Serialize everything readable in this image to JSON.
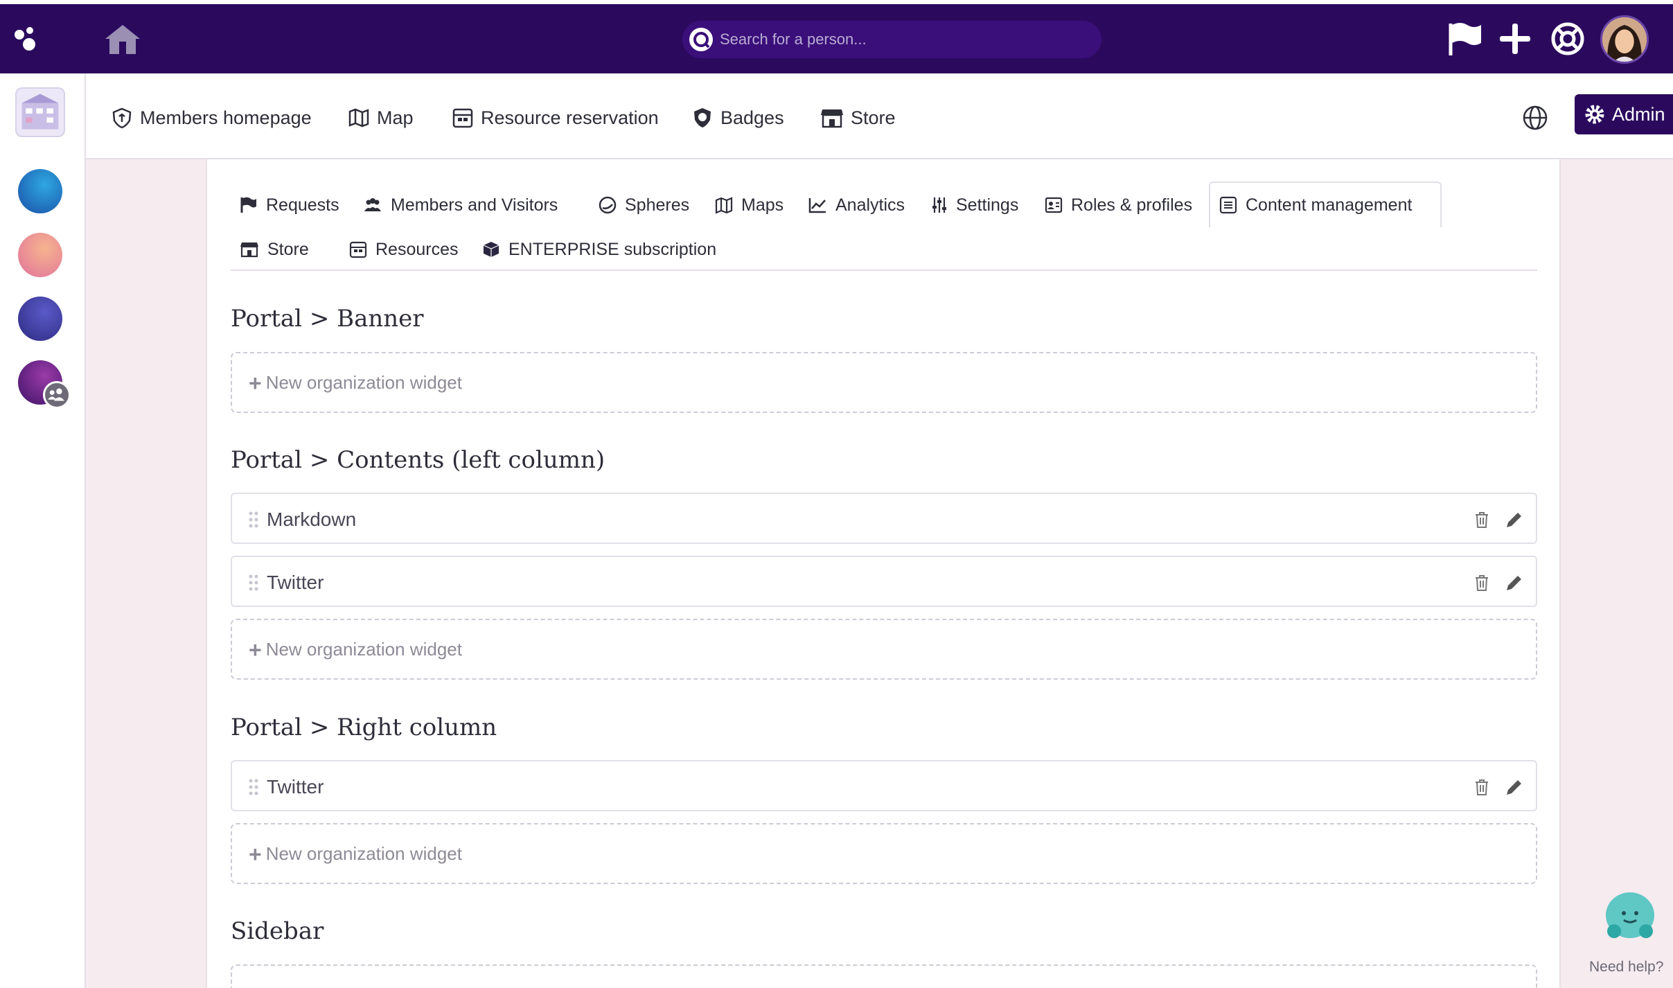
{
  "topbar": {
    "search_placeholder": "Search for a person...",
    "icons": [
      "logo-icon",
      "home-icon",
      "flag-icon",
      "plus-icon",
      "help-ring-icon",
      "user-avatar"
    ]
  },
  "rail": {
    "spheres": [
      {
        "name": "sphere-blue",
        "color": "#1f74c9"
      },
      {
        "name": "sphere-pink",
        "color": "#e98a98"
      },
      {
        "name": "sphere-indigo",
        "color": "#3b3a9a"
      },
      {
        "name": "sphere-purple",
        "color": "#5a1f7a"
      }
    ]
  },
  "navbar": {
    "items": [
      {
        "label": "Members homepage",
        "icon": "shield-home-icon"
      },
      {
        "label": "Map",
        "icon": "map-icon"
      },
      {
        "label": "Resource reservation",
        "icon": "calendar-icon"
      },
      {
        "label": "Badges",
        "icon": "badge-icon"
      },
      {
        "label": "Store",
        "icon": "store-icon"
      }
    ],
    "admin_label": "Admin"
  },
  "tabs": {
    "row1": [
      {
        "label": "Requests",
        "icon": "flag-icon"
      },
      {
        "label": "Members and Visitors",
        "icon": "users-icon"
      },
      {
        "label": "Spheres",
        "icon": "sphere-icon"
      },
      {
        "label": "Maps",
        "icon": "map-icon"
      },
      {
        "label": "Analytics",
        "icon": "chart-line-icon"
      },
      {
        "label": "Settings",
        "icon": "sliders-icon"
      },
      {
        "label": "Roles & profiles",
        "icon": "id-card-icon"
      },
      {
        "label": "Content management",
        "icon": "list-icon",
        "active": true
      }
    ],
    "row2": [
      {
        "label": "Store",
        "icon": "store-icon"
      },
      {
        "label": "Resources",
        "icon": "calendar-icon"
      },
      {
        "label": "ENTERPRISE subscription",
        "icon": "cube-icon"
      }
    ]
  },
  "sections": [
    {
      "title": "Portal > Banner",
      "widgets": [],
      "add_label": "New organization widget"
    },
    {
      "title": "Portal > Contents (left column)",
      "widgets": [
        "Markdown",
        "Twitter"
      ],
      "add_label": "New organization widget"
    },
    {
      "title": "Portal > Right column",
      "widgets": [
        "Twitter"
      ],
      "add_label": "New organization widget"
    },
    {
      "title": "Sidebar",
      "widgets": [],
      "add_label": ""
    }
  ],
  "help": {
    "label": "Need help?"
  },
  "colors": {
    "brand": "#2b0a5e",
    "background": "#f6ebef"
  }
}
